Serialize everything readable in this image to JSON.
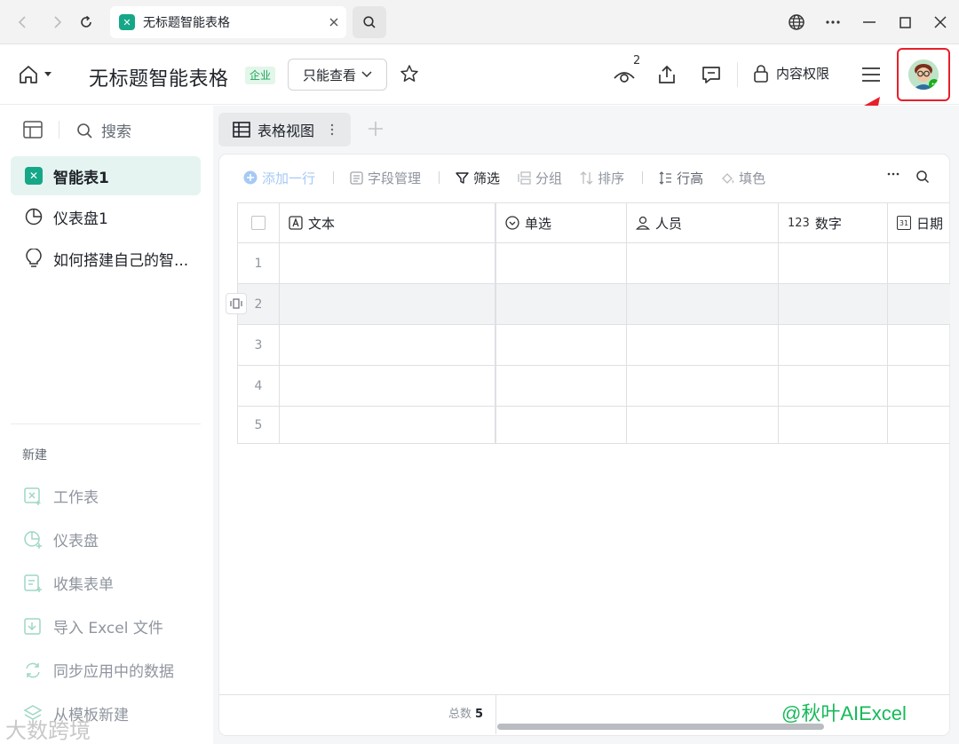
{
  "browser": {
    "tab_title": "无标题智能表格",
    "favicon_glyph": "✕"
  },
  "header": {
    "doc_title": "无标题智能表格",
    "badge": "企业",
    "permission_button": "只能查看",
    "viewer_count": "2",
    "content_permission": "内容权限"
  },
  "sidebar": {
    "search_placeholder": "搜索",
    "items": [
      {
        "label": "智能表1",
        "icon": "smart-table-icon",
        "active": true
      },
      {
        "label": "仪表盘1",
        "icon": "dashboard-icon",
        "active": false
      },
      {
        "label": "如何搭建自己的智...",
        "icon": "lightbulb-icon",
        "active": false
      }
    ],
    "new_section_label": "新建",
    "new_items": [
      {
        "label": "工作表",
        "icon": "worksheet-icon"
      },
      {
        "label": "仪表盘",
        "icon": "dashboard-icon"
      },
      {
        "label": "收集表单",
        "icon": "form-icon"
      },
      {
        "label": "导入 Excel 文件",
        "icon": "import-icon"
      },
      {
        "label": "同步应用中的数据",
        "icon": "sync-icon"
      },
      {
        "label": "从模板新建",
        "icon": "template-icon"
      }
    ]
  },
  "view_tab": {
    "label": "表格视图"
  },
  "toolbar": {
    "add_row": "添加一行",
    "field_manage": "字段管理",
    "filter": "筛选",
    "group": "分组",
    "sort": "排序",
    "row_height": "行高",
    "fill_color": "填色"
  },
  "grid": {
    "columns": [
      {
        "label": "文本",
        "icon": "text-field-icon"
      },
      {
        "label": "单选",
        "icon": "single-select-icon"
      },
      {
        "label": "人员",
        "icon": "person-icon"
      },
      {
        "label": "数字",
        "icon": "number-icon",
        "prefix": "123"
      },
      {
        "label": "日期",
        "icon": "calendar-icon",
        "prefix": "31"
      }
    ],
    "rows": [
      "1",
      "2",
      "3",
      "4",
      "5"
    ],
    "footer_total_label": "总数",
    "footer_total_value": "5"
  },
  "watermarks": {
    "right": "@秋叶AIExcel",
    "left": "大数跨境"
  },
  "colors": {
    "accent_green": "#15a788",
    "active_bg": "#e5f4f0",
    "highlight_red": "#e8202a"
  }
}
